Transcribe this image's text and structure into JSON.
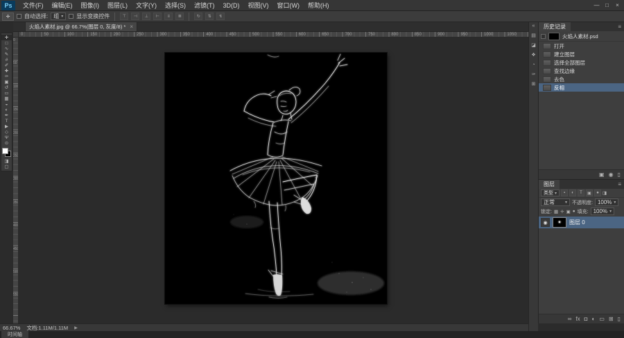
{
  "menu_bar": {
    "logo": "Ps",
    "items": [
      {
        "label": "文件(F)"
      },
      {
        "label": "编辑(E)"
      },
      {
        "label": "图像(I)"
      },
      {
        "label": "图层(L)"
      },
      {
        "label": "文字(Y)"
      },
      {
        "label": "选择(S)"
      },
      {
        "label": "滤镜(T)"
      },
      {
        "label": "3D(D)"
      },
      {
        "label": "视图(V)"
      },
      {
        "label": "窗口(W)"
      },
      {
        "label": "帮助(H)"
      }
    ],
    "window_controls": {
      "minimize": "—",
      "maximize": "□",
      "close": "×"
    }
  },
  "options_bar": {
    "tool_icon": "✛",
    "auto_select_label": "自动选择:",
    "auto_select_value": "组",
    "dropdown_arrow": "▾",
    "show_transform_label": "显示变换控件",
    "align_icons": [
      "⊤",
      "⊣",
      "⊥",
      "⊢",
      "≡",
      "≣"
    ],
    "mode_icons": [
      "↻",
      "⇅",
      "↯"
    ]
  },
  "document_tab": {
    "title": "火焰人素材.jpg @ 66.7%(图层 0, 灰度/8) *",
    "close_icon": "×"
  },
  "tools": [
    {
      "name": "move",
      "glyph": "✛"
    },
    {
      "name": "marquee",
      "glyph": "□"
    },
    {
      "name": "lasso",
      "glyph": "∿"
    },
    {
      "name": "quick-selection",
      "glyph": "✎"
    },
    {
      "name": "crop",
      "glyph": "#"
    },
    {
      "name": "eyedropper",
      "glyph": "✐"
    },
    {
      "name": "healing-brush",
      "glyph": "✚"
    },
    {
      "name": "brush",
      "glyph": "✑"
    },
    {
      "name": "clone-stamp",
      "glyph": "▣"
    },
    {
      "name": "history-brush",
      "glyph": "↺"
    },
    {
      "name": "eraser",
      "glyph": "▭"
    },
    {
      "name": "gradient",
      "glyph": "▦"
    },
    {
      "name": "blur",
      "glyph": "◒"
    },
    {
      "name": "dodge",
      "glyph": "◐"
    },
    {
      "name": "pen",
      "glyph": "✒"
    },
    {
      "name": "type",
      "glyph": "T"
    },
    {
      "name": "path-selection",
      "glyph": "▶"
    },
    {
      "name": "shape",
      "glyph": "◇"
    },
    {
      "name": "hand",
      "glyph": "Ψ"
    },
    {
      "name": "zoom",
      "glyph": "⊙"
    }
  ],
  "toolbar_extra": {
    "quick_mask": "◨",
    "screen_mode": "▢"
  },
  "rulers": {
    "top": {
      "start": 0,
      "step": 50,
      "count": 22
    },
    "left": {
      "start": 0,
      "step": 50,
      "count": 12
    }
  },
  "dock": {
    "collapse": "«",
    "icons": [
      {
        "name": "color-panel",
        "glyph": "▤"
      },
      {
        "name": "adjustments-panel",
        "glyph": "◪"
      },
      {
        "name": "styles-panel",
        "glyph": "❖"
      },
      {
        "name": "info-panel",
        "glyph": "◔"
      },
      {
        "name": "brush-panel",
        "glyph": "✑"
      },
      {
        "name": "clone-source-panel",
        "glyph": "⊞"
      }
    ]
  },
  "history_panel": {
    "tab": "历史记录",
    "menu_icon": "≡",
    "snapshot": {
      "name": "火焰人素材.psd"
    },
    "items": [
      {
        "label": "打开"
      },
      {
        "label": "建立图层"
      },
      {
        "label": "选择全部图层"
      },
      {
        "label": "查找边缘"
      },
      {
        "label": "去色"
      },
      {
        "label": "反相"
      }
    ],
    "footer_icons": [
      {
        "name": "new-document-from-state",
        "glyph": "▣"
      },
      {
        "name": "new-snapshot",
        "glyph": "◉"
      },
      {
        "name": "delete-state",
        "glyph": "▯"
      }
    ]
  },
  "layers_panel": {
    "tab": "图层",
    "menu_icon": "≡",
    "filter_label": "类型",
    "dropdown_arrow": "▾",
    "filter_icons": [
      "▪",
      "◐",
      "T",
      "▣",
      "●"
    ],
    "filter_toggle": "◨",
    "blend_mode": "正常",
    "opacity_label": "不透明度:",
    "opacity_value": "100%",
    "lock_label": "锁定:",
    "lock_icons": [
      "▦",
      "✛",
      "▣",
      "●"
    ],
    "fill_label": "填充:",
    "fill_value": "100%",
    "layers": [
      {
        "name": "图层 0",
        "eye": "◉"
      }
    ],
    "footer_icons": [
      {
        "name": "link-layers",
        "glyph": "∞"
      },
      {
        "name": "layer-style",
        "glyph": "fx"
      },
      {
        "name": "add-layer-mask",
        "glyph": "◘"
      },
      {
        "name": "adjustment-layer",
        "glyph": "◐"
      },
      {
        "name": "new-group",
        "glyph": "▭"
      },
      {
        "name": "new-layer",
        "glyph": "⊞"
      },
      {
        "name": "delete-layer",
        "glyph": "▯"
      }
    ]
  },
  "status_bar": {
    "zoom": "66.67%",
    "doc_info": "文档:1.11M/1.11M",
    "flyout": "▶"
  },
  "timeline_tab": {
    "label": "时间轴"
  }
}
